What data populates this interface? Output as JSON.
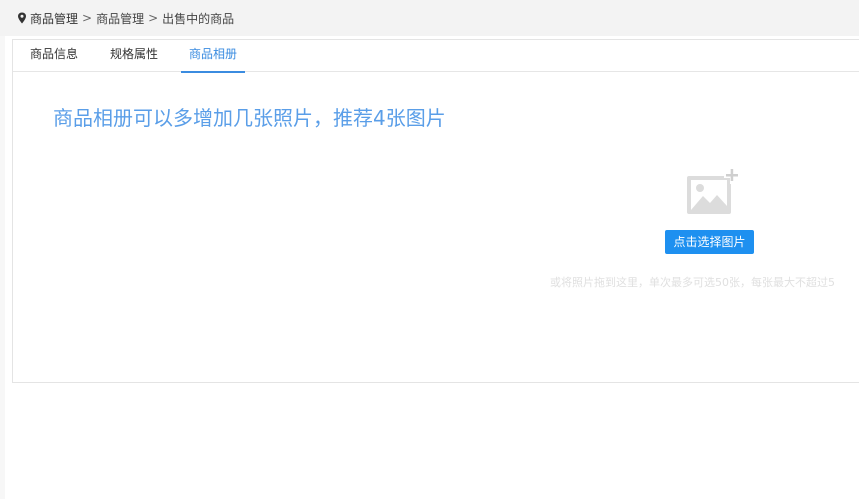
{
  "breadcrumb": {
    "root": "商品管理",
    "separator": ">",
    "parent": "商品管理",
    "current": "出售中的商品"
  },
  "tabs": [
    {
      "label": "商品信息",
      "active": false
    },
    {
      "label": "规格属性",
      "active": false
    },
    {
      "label": "商品相册",
      "active": true
    }
  ],
  "gallery": {
    "hint": "商品相册可以多增加几张照片，推荐4张图片",
    "select_button": "点击选择图片",
    "drop_hint": "或将照片拖到这里，单次最多可选50张，每张最大不超过5"
  },
  "colors": {
    "accent": "#3b8ce0",
    "button": "#1e90f0",
    "hint_text": "#5a9ee8"
  }
}
